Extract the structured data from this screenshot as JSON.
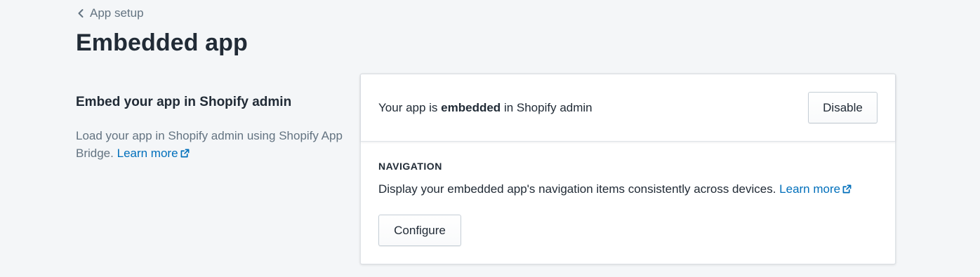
{
  "breadcrumb": {
    "label": "App setup",
    "icon": "chevron-left-icon"
  },
  "page": {
    "title": "Embedded app"
  },
  "annotation": {
    "heading": "Embed your app in Shopify admin",
    "description": "Load your app in Shopify admin using Shopify App Bridge.",
    "learn_more": "Learn more",
    "learn_more_icon": "external-link-icon"
  },
  "status": {
    "prefix": "Your app is",
    "state": "embedded",
    "suffix": "in Shopify admin",
    "button_label": "Disable"
  },
  "navigation": {
    "heading": "NAVIGATION",
    "description": "Display your embedded app's navigation items consistently across devices.",
    "learn_more": "Learn more",
    "learn_more_icon": "external-link-icon",
    "button_label": "Configure"
  },
  "colors": {
    "background": "#f4f6f8",
    "text": "#212b36",
    "subdued_text": "#637381",
    "link": "#006fbb",
    "border": "#dfe3e8"
  }
}
